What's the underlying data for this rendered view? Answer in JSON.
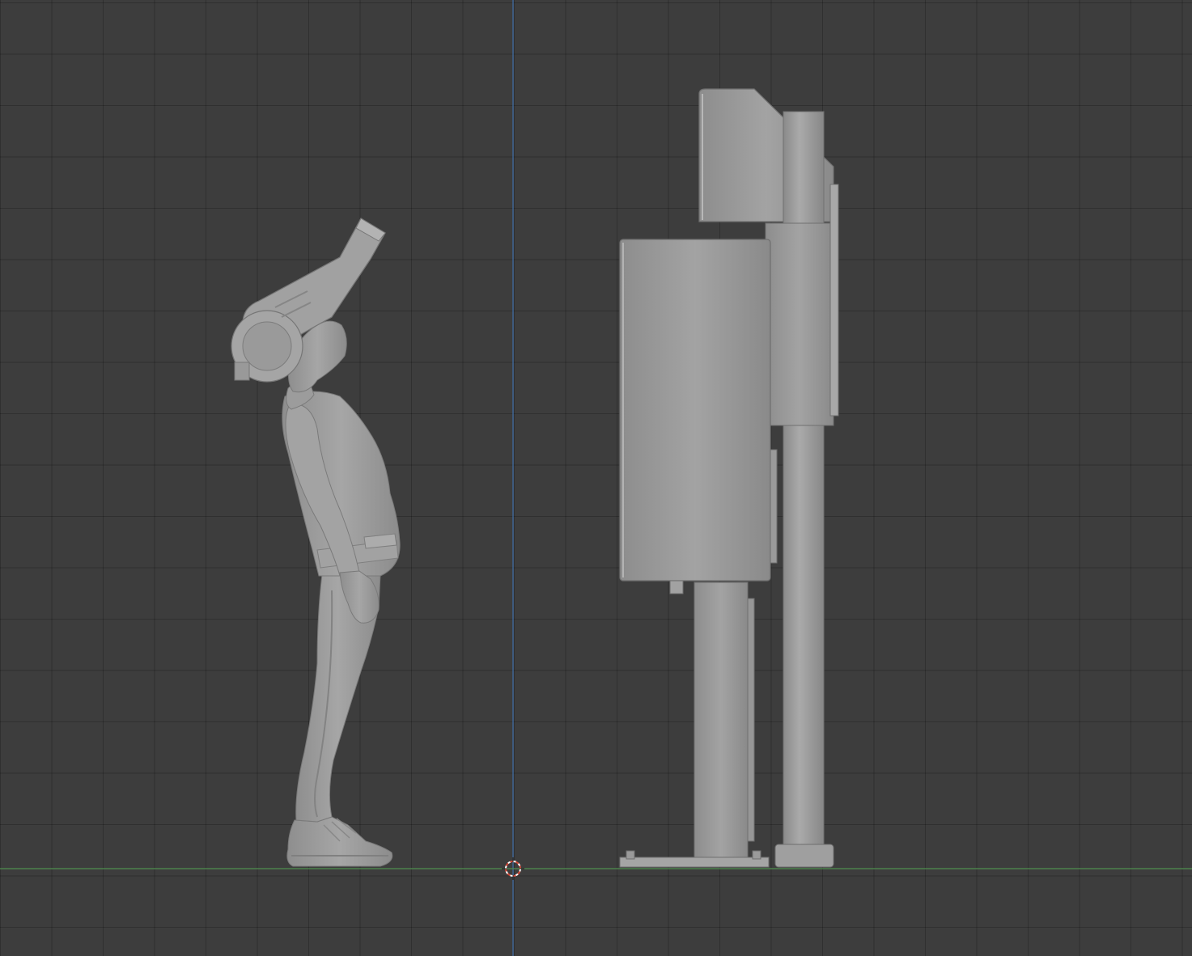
{
  "viewport": {
    "background": "#3d3d3d",
    "grid_color": "#353535",
    "axis_x_color": "#4f8f4f",
    "axis_z_color": "#3f6fa8",
    "object_color": "#9b9b9b",
    "shade_light": "#b0b0b0",
    "shade_dark": "#7c7c7c",
    "cursor_color": "#d34a3a"
  },
  "objects": [
    {
      "name": "human-figure"
    },
    {
      "name": "kiosk-machine"
    }
  ],
  "icons": [
    "3d-cursor-icon"
  ]
}
